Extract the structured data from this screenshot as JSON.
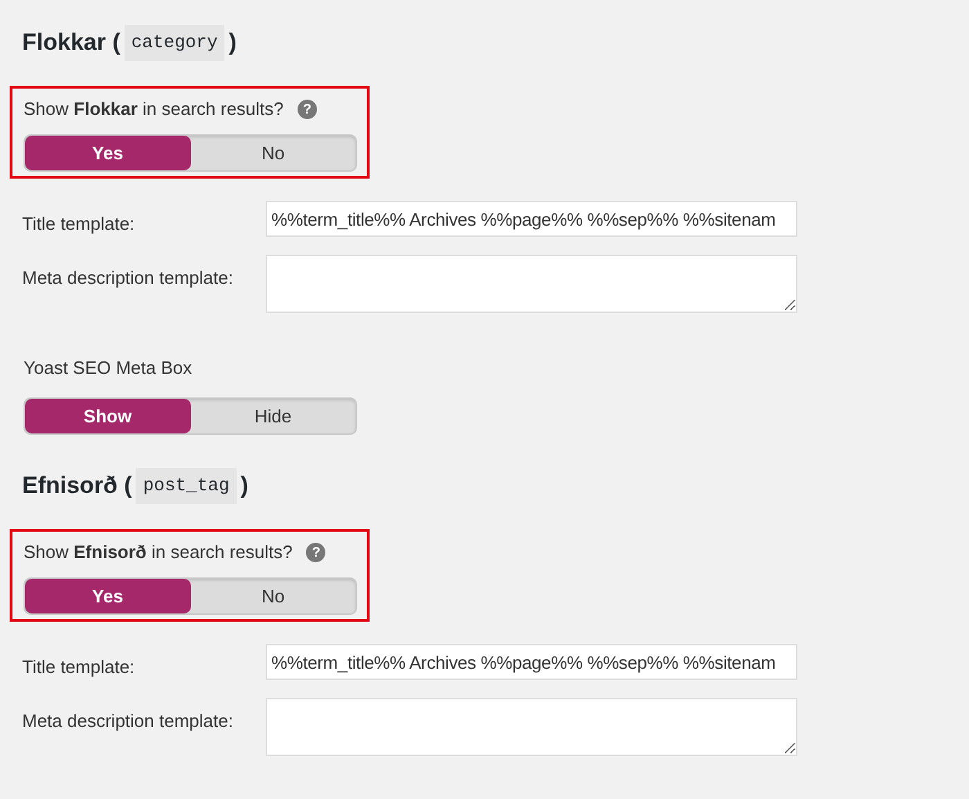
{
  "sections": [
    {
      "heading": {
        "before": "Flokkar (",
        "code": "category",
        "after": ")"
      },
      "search_setting": {
        "highlighted": true,
        "question": "Show **Flokkar** in search results?",
        "help": "?",
        "options": [
          {
            "label": "Yes",
            "selected": true
          },
          {
            "label": "No",
            "selected": false
          }
        ]
      },
      "fields": [
        {
          "kind": "text",
          "label": "Title template:",
          "value": "%%term_title%% Archives %%page%% %%sep%% %%sitenam"
        },
        {
          "kind": "textarea",
          "label": "Meta description template:"
        }
      ],
      "meta_box": {
        "label": "Yoast SEO Meta Box",
        "options": [
          {
            "label": "Show",
            "selected": true
          },
          {
            "label": "Hide",
            "selected": false
          }
        ]
      }
    },
    {
      "heading": {
        "before": "Efnisorð (",
        "code": "post_tag",
        "after": ")"
      },
      "search_setting": {
        "highlighted": true,
        "question": "Show **Efnisorð** in search results?",
        "help": "?",
        "options": [
          {
            "label": "Yes",
            "selected": true
          },
          {
            "label": "No",
            "selected": false
          }
        ]
      },
      "fields": [
        {
          "kind": "text",
          "label": "Title template:",
          "value": "%%term_title%% Archives %%page%% %%sep%% %%sitenam"
        },
        {
          "kind": "textarea",
          "label": "Meta description template:"
        }
      ]
    }
  ]
}
